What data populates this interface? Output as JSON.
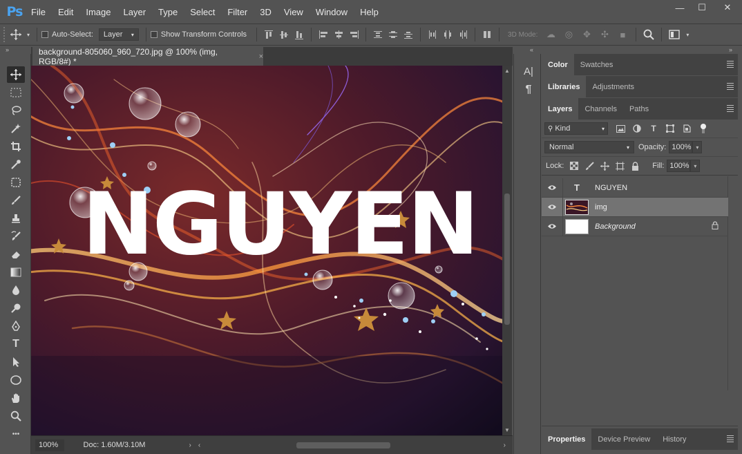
{
  "app": {
    "logo": "Ps",
    "menu": [
      "File",
      "Edit",
      "Image",
      "Layer",
      "Type",
      "Select",
      "Filter",
      "3D",
      "View",
      "Window",
      "Help"
    ],
    "window_controls": {
      "minimize": "—",
      "maximize": "☐",
      "close": "✕"
    }
  },
  "options_bar": {
    "auto_select_label": "Auto-Select:",
    "auto_select_target": "Layer",
    "show_transform_label": "Show Transform Controls",
    "mode_3d_label": "3D Mode:"
  },
  "panel_collapse": {
    "left": "»",
    "right": "»",
    "mid": "«"
  },
  "document": {
    "tab_title": "background-805060_960_720.jpg @ 100% (img, RGB/8#) *",
    "close": "×",
    "canvas_text": "NGUYEN"
  },
  "status": {
    "zoom": "100%",
    "doc_info": "Doc: 1.60M/3.10M",
    "arrow": "›",
    "scroll_left": "‹",
    "scroll_right": "›",
    "scroll_up": "▲",
    "scroll_down": "▼"
  },
  "tools": [
    "move-tool",
    "marquee-tool",
    "lasso-tool",
    "quick-select-tool",
    "crop-tool",
    "eyedropper-tool",
    "healing-tool",
    "brush-tool",
    "stamp-tool",
    "history-brush-tool",
    "eraser-tool",
    "gradient-tool",
    "blur-tool",
    "dodge-tool",
    "pen-tool",
    "type-tool",
    "path-select-tool",
    "ellipse-tool",
    "hand-tool",
    "zoom-tool",
    "more-tools"
  ],
  "tool_glyphs": {
    "type": "T",
    "more": "•••"
  },
  "narrow_panel": {
    "char": "A|",
    "para": "¶"
  },
  "panels": {
    "top_tabs": [
      "Color",
      "Swatches"
    ],
    "mid_tabs": [
      "Libraries",
      "Adjustments"
    ],
    "layer_tabs": [
      "Layers",
      "Channels",
      "Paths"
    ],
    "bottom_tabs": [
      "Properties",
      "Device Preview",
      "History"
    ]
  },
  "layers_panel": {
    "kind_label": "Kind",
    "blend_mode": "Normal",
    "opacity_label": "Opacity:",
    "opacity_value": "100%",
    "lock_label": "Lock:",
    "fill_label": "Fill:",
    "fill_value": "100%",
    "layers": [
      {
        "name": "NGUYEN",
        "kind": "text",
        "thumb_glyph": "T",
        "selected": false,
        "italic": false,
        "locked": false
      },
      {
        "name": "img",
        "kind": "image",
        "selected": true,
        "italic": false,
        "locked": false
      },
      {
        "name": "Background",
        "kind": "background",
        "selected": false,
        "italic": true,
        "locked": true
      }
    ]
  },
  "colors": {
    "ui_bg": "#535353",
    "ui_dark": "#3b3b3b",
    "accent_logo": "#4aa3f0",
    "selected_layer": "#737373"
  }
}
